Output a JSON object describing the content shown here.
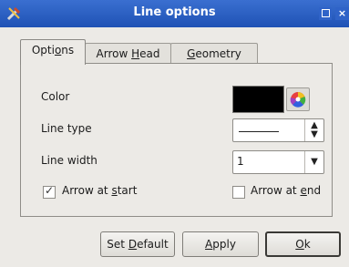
{
  "window": {
    "title": "Line options"
  },
  "titlebar_buttons": {
    "close": "×"
  },
  "tabs": [
    {
      "label_pre": "Opti",
      "label_u": "o",
      "label_post": "ns"
    },
    {
      "label_pre": "Arrow ",
      "label_u": "H",
      "label_post": "ead"
    },
    {
      "label_pre": "",
      "label_u": "G",
      "label_post": "eometry"
    }
  ],
  "options": {
    "color_label": "Color",
    "color_value": "#000000",
    "line_type_label": "Line type",
    "line_width_label": "Line width",
    "line_width_value": "1",
    "arrow_start": {
      "pre": "Arrow at ",
      "u": "s",
      "post": "tart",
      "checked": true
    },
    "arrow_end": {
      "pre": "Arrow at ",
      "u": "e",
      "post": "nd",
      "checked": false
    }
  },
  "buttons": {
    "set_default": {
      "pre": "Set ",
      "u": "D",
      "post": "efault"
    },
    "apply": {
      "pre": "",
      "u": "A",
      "post": "pply"
    },
    "ok": {
      "pre": "",
      "u": "O",
      "post": "k"
    }
  },
  "icons": {
    "app": "tools-icon",
    "color_picker": "color-wheel-icon"
  }
}
